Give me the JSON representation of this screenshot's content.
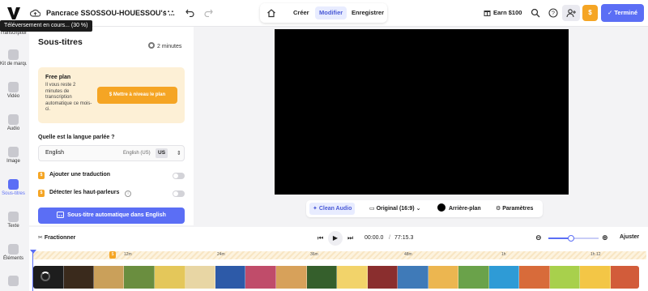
{
  "app": {
    "project_title": "Pancrace SSOSSOU-HOUESSOU's ...",
    "upload_tooltip": "Téléversement en cours... (30 %)",
    "modes": [
      {
        "label": "Créer",
        "active": false
      },
      {
        "label": "Modifier",
        "active": true
      },
      {
        "label": "Enregistrer",
        "active": false
      }
    ],
    "earn_label": "Earn $100",
    "done_label": "Terminé",
    "coin_symbol": "$",
    "accent_color": "#5b6ef5",
    "warning_color": "#f5a524"
  },
  "rail": {
    "items": [
      {
        "label": "Transcription",
        "icon": "transcript-icon"
      },
      {
        "label": "Kit de marque",
        "icon": "brand-kit-icon"
      },
      {
        "label": "Vidéo",
        "icon": "video-icon"
      },
      {
        "label": "Audio",
        "icon": "audio-icon"
      },
      {
        "label": "Image",
        "icon": "image-icon"
      },
      {
        "label": "Sous-titres",
        "icon": "subtitles-icon",
        "active": true
      },
      {
        "label": "Texte",
        "icon": "text-icon"
      },
      {
        "label": "Éléments",
        "icon": "elements-icon"
      },
      {
        "label": "",
        "icon": "more-tools-icon"
      }
    ]
  },
  "panel": {
    "title": "Sous-titres",
    "duration": "2 minutes",
    "plan": {
      "title": "Free plan",
      "description": "Il vous reste 2 minutes de transcription automatique ce mois-ci.",
      "upgrade_label": "Mettre à niveau le plan"
    },
    "language_question": "Quelle est la langue parlée ?",
    "language": {
      "value": "English",
      "code": "English (US)",
      "short": "US"
    },
    "options": [
      {
        "label": "Ajouter une traduction",
        "badge": "$",
        "enabled": false
      },
      {
        "label": "Détecter les haut-parleurs",
        "badge": "$",
        "enabled": false,
        "info": true
      }
    ],
    "auto_button_label": "Sous-titre automatique dans English"
  },
  "video_tools": {
    "clean_audio": "Clean Audio",
    "ratio": "Original (16:9)",
    "background": "Arrière-plan",
    "settings": "Paramètres"
  },
  "timeline": {
    "split_label": "Fractionner",
    "current_time": "00:00.0",
    "separator": "/",
    "total_time": "77:15.3",
    "fit_label": "Ajuster",
    "zoom_level": 0.45,
    "ruler_ticks": [
      "12m",
      "24m",
      "36m",
      "48m",
      "1h",
      "1h 12"
    ],
    "ruler_badge": "$"
  }
}
